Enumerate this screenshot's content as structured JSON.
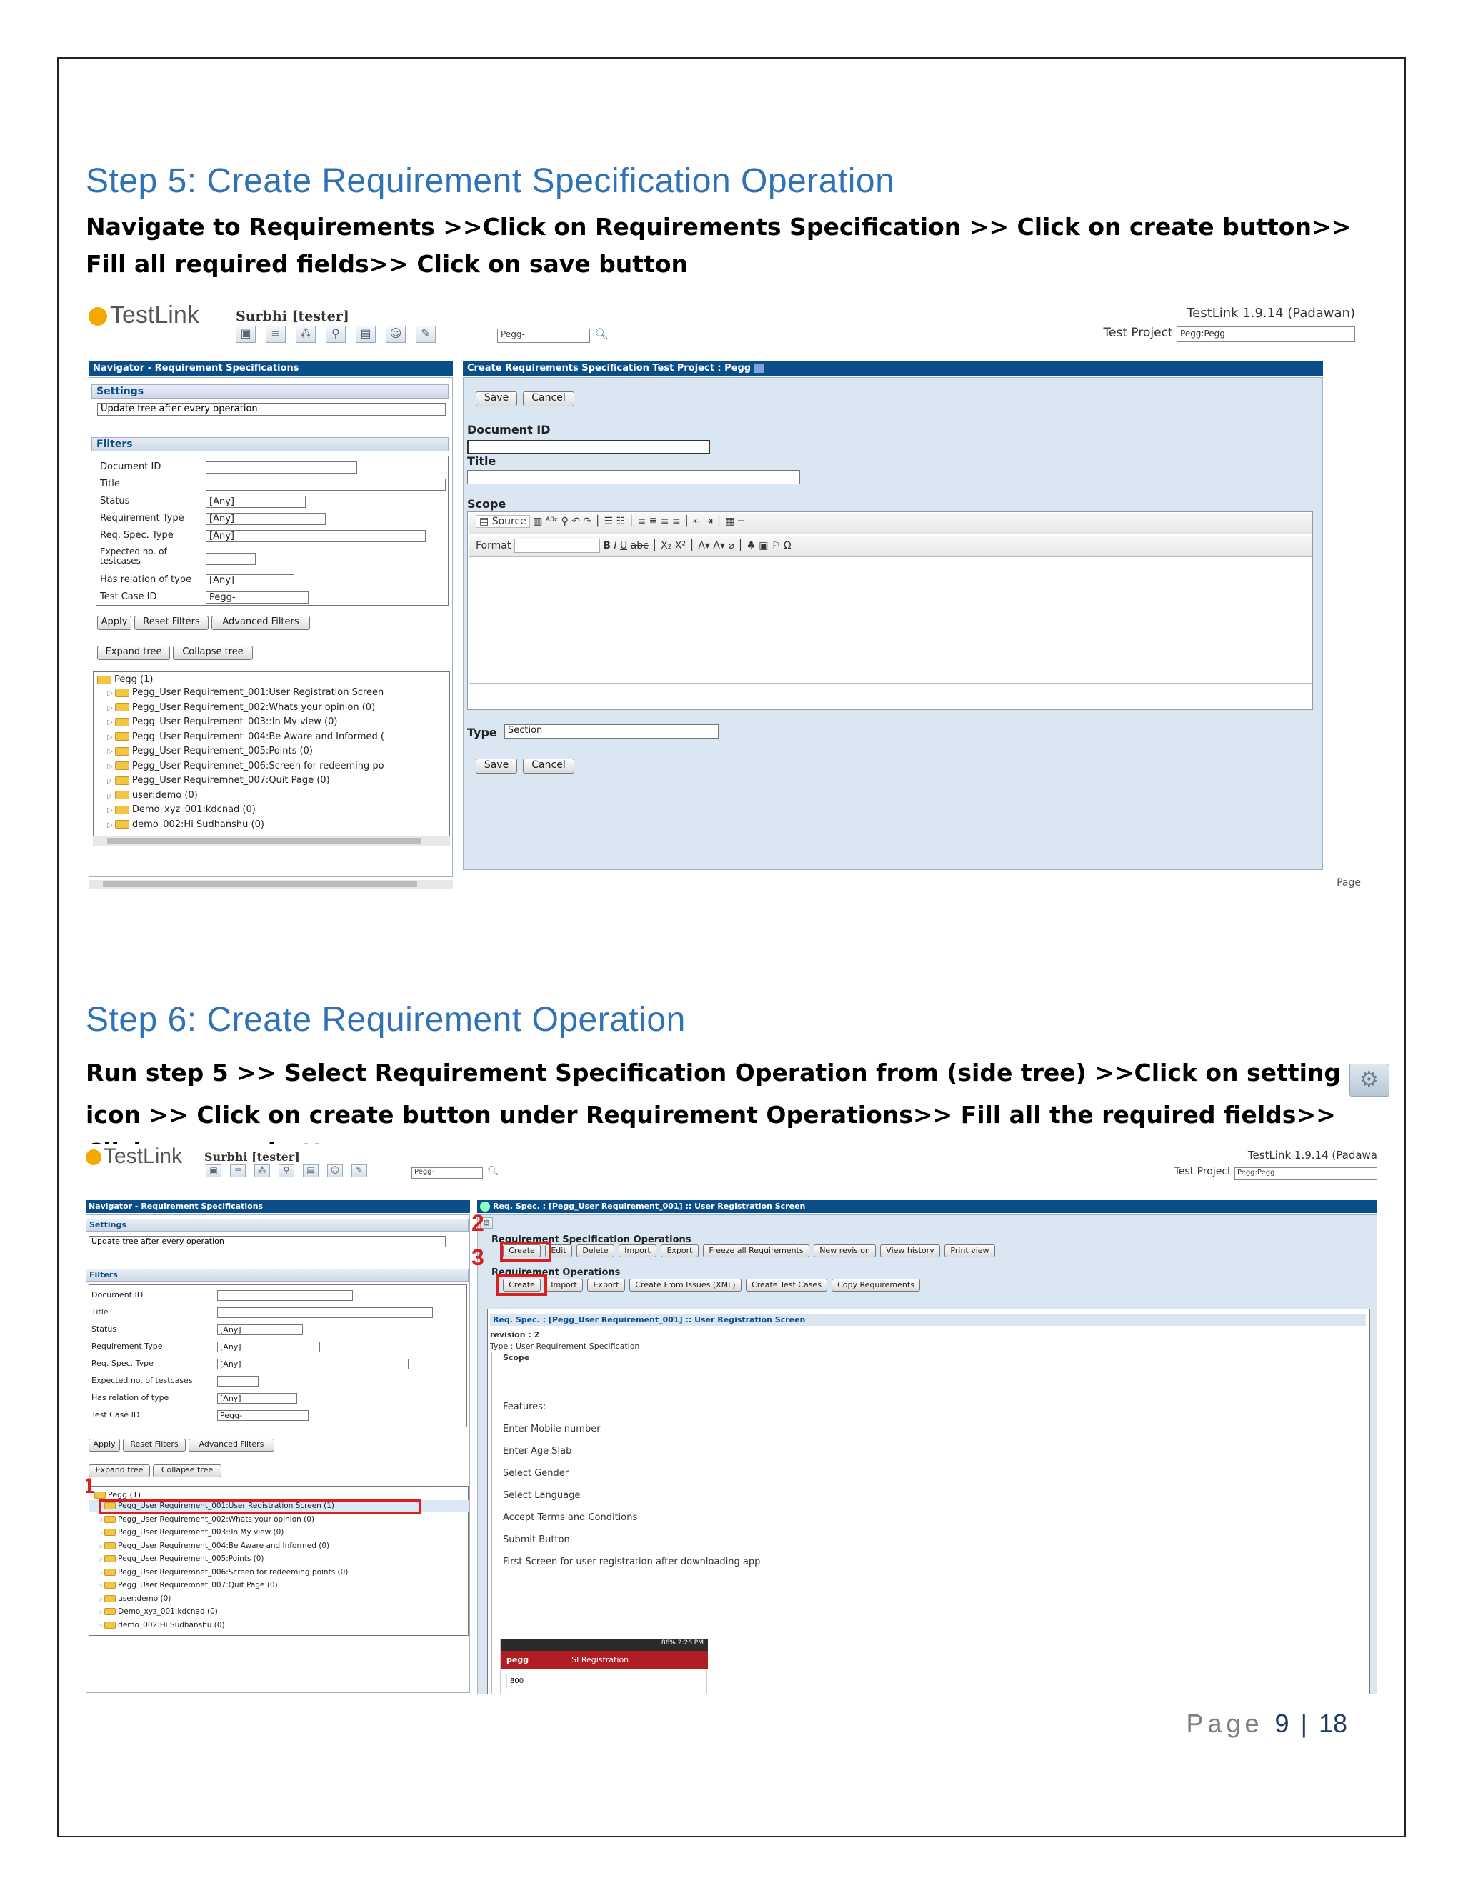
{
  "step5": {
    "heading": "Step 5: Create Requirement Specification Operation",
    "instruction": "Navigate to Requirements >>Click on Requirements Specification >> Click on create button>> Fill all required fields>> Click on save button"
  },
  "step6": {
    "heading": "Step 6: Create Requirement Operation",
    "instruction_part1": "Run step 5 >> Select Requirement Specification Operation from (side tree) >>Click on setting",
    "instruction_part2": "icon >> Click on create button under Requirement Operations>> Fill all the required fields>> Click on save button"
  },
  "footer": {
    "page_word": "Page",
    "page_number": "9",
    "separator": "|",
    "total_pages": "18"
  },
  "testlink": {
    "logo": "TestLink",
    "user": "Surbhi [tester]",
    "search_value": "Pegg-",
    "version": "TestLink 1.9.14 (Padawan)",
    "version_cut": "TestLink 1.9.14 (Padawa",
    "test_project_label": "Test Project",
    "test_project_value": "Pegg:Pegg",
    "navigator_title": "Navigator - Requirement Specifications",
    "settings_label": "Settings",
    "update_tree": "Update tree after every operation",
    "filters_label": "Filters",
    "filters": {
      "document_id": "Document ID",
      "title": "Title",
      "status": "Status",
      "requirement_type": "Requirement Type",
      "req_spec_type": "Req. Spec. Type",
      "expected_no": "Expected no. of testcases",
      "expected_no_a": "Expected no. of",
      "expected_no_b": "testcases",
      "has_relation": "Has relation of type",
      "test_case_id": "Test Case ID",
      "any": "[Any]",
      "test_case_value": "Pegg-"
    },
    "apply": "Apply",
    "reset_filters": "Reset Filters",
    "advanced_filters": "Advanced Filters",
    "expand_tree": "Expand tree",
    "collapse_tree": "Collapse tree",
    "tree_root": "Pegg (1)",
    "tree_items_1": [
      "Pegg_User Requirement_001:User Registration Screen",
      "Pegg_User Requirement_002:Whats your opinion (0)",
      "Pegg_User Requirement_003::In My view (0)",
      "Pegg_User Requirement_004:Be Aware and Informed (",
      "Pegg_User Requirement_005:Points (0)",
      "Pegg_User Requiremnet_006:Screen for redeeming po",
      "Pegg_User Requiremnet_007:Quit Page (0)",
      "user:demo (0)",
      "Demo_xyz_001:kdcnad (0)",
      "demo_002:Hi Sudhanshu (0)"
    ],
    "tree_items_2": [
      "Pegg_User Requirement_001:User Registration Screen (1)",
      "Pegg_User Requirement_002:Whats your opinion (0)",
      "Pegg_User Requirement_003::In My view (0)",
      "Pegg_User Requirement_004:Be Aware and Informed (0)",
      "Pegg_User Requirement_005:Points (0)",
      "Pegg_User Requiremnet_006:Screen for redeeming points (0)",
      "Pegg_User Requiremnet_007:Quit Page (0)",
      "user:demo (0)",
      "Demo_xyz_001:kdcnad (0)",
      "demo_002:Hi Sudhanshu (0)"
    ],
    "create_spec_title": "Create Requirements Specification Test Project : Pegg",
    "save": "Save",
    "cancel": "Cancel",
    "document_id": "Document ID",
    "title": "Title",
    "scope": "Scope",
    "toolbar_row1": "Source",
    "format": "Format",
    "type_label": "Type",
    "type_value": "Section",
    "page_cut": "Page",
    "req_spec_title": "Req. Spec. : [Pegg_User Requirement_001] :: User Registration Screen",
    "req_spec_ops": "Requirement Specification Operations",
    "spec_buttons": [
      "Create",
      "Edit",
      "Delete",
      "Import",
      "Export",
      "Freeze all Requirements",
      "New revision",
      "View history",
      "Print view"
    ],
    "req_ops": "Requirement Operations",
    "req_buttons": [
      "Create",
      "Import",
      "Export",
      "Create From Issues (XML)",
      "Create Test Cases",
      "Copy Requirements"
    ],
    "detail_title": "Req. Spec. : [Pegg_User Requirement_001] :: User Registration Screen",
    "revision": "revision : 2",
    "type_line": "Type : User Requirement Specification",
    "scope_label": "Scope",
    "scope_lines": [
      "Features:",
      "Enter Mobile number",
      "Enter Age Slab",
      "Select Gender",
      "Select Language",
      "Accept Terms and Conditions",
      "Submit Button",
      "First Screen for user registration after downloading app"
    ],
    "phone_status": "86% 2:26 PM",
    "phone_brand": "pegg",
    "phone_title": "SI Registration",
    "phone_field": "800",
    "marker_1": "1",
    "marker_2": "2",
    "marker_3": "3"
  }
}
